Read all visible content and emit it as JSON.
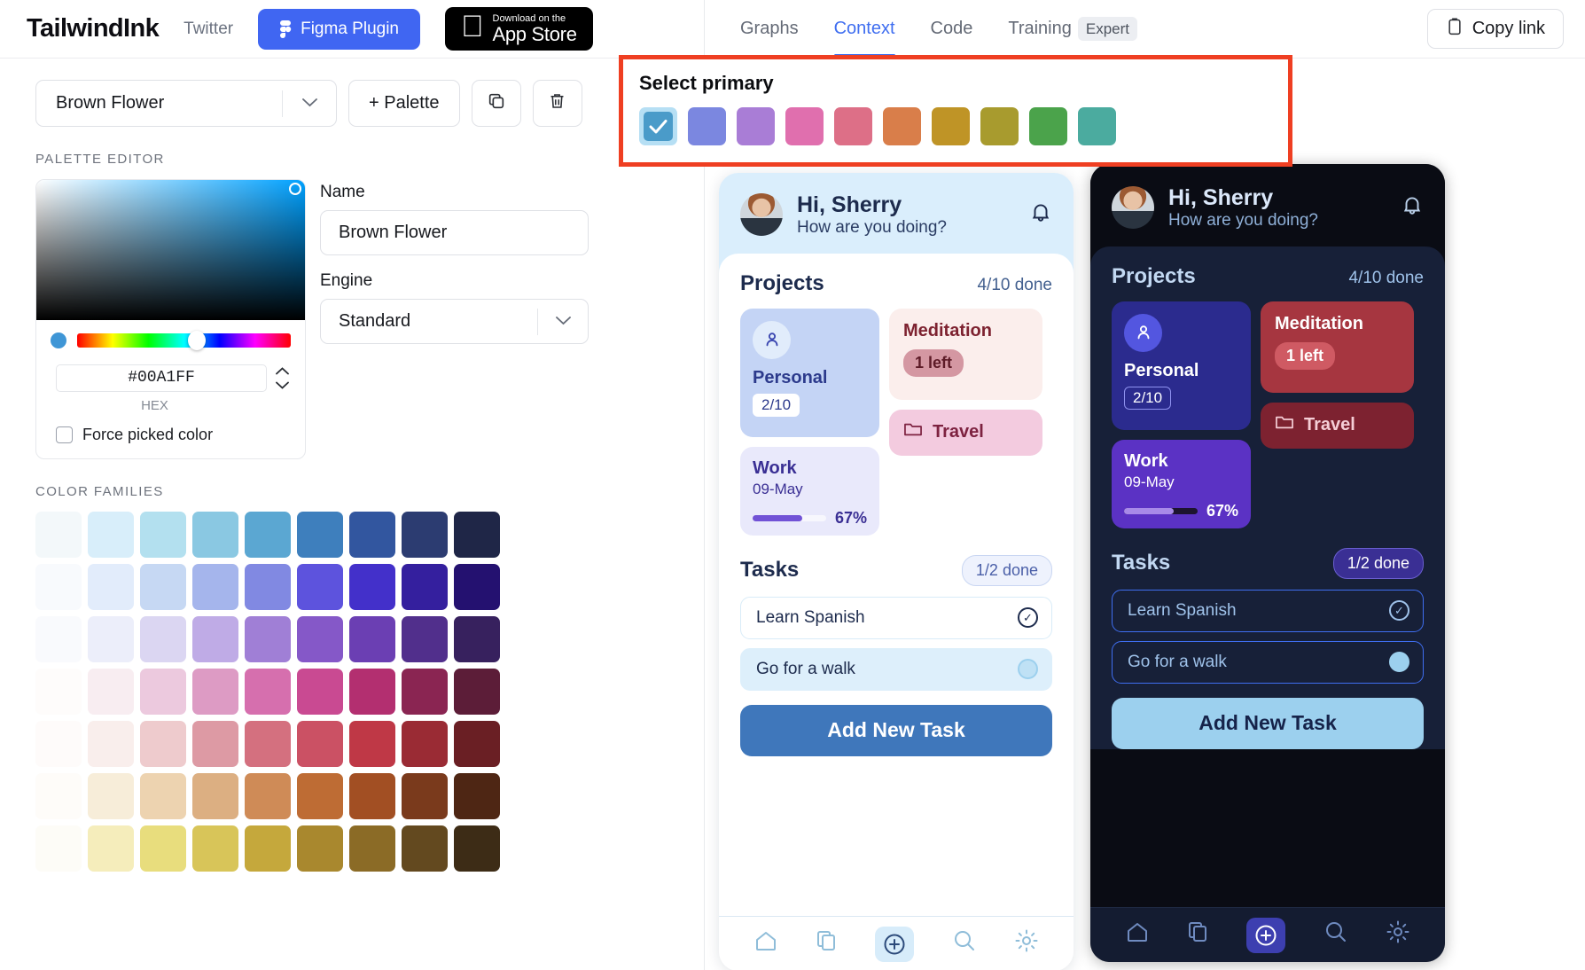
{
  "brand": {
    "logo": "TailwindInk",
    "twitter": "Twitter",
    "figma": "Figma Plugin",
    "appstore_small": "Download on the",
    "appstore_big": "App Store"
  },
  "palette_bar": {
    "selected_palette": "Brown Flower",
    "add_palette": "+ Palette",
    "duplicate_icon": "copy-icon",
    "delete_icon": "trash-icon",
    "chevron": "⌄"
  },
  "palette_editor": {
    "section_label": "PALETTE EDITOR",
    "hex_value": "#00A1FF",
    "hex_label": "HEX",
    "force_label": "Force picked color",
    "name_label": "Name",
    "name_value": "Brown Flower",
    "engine_label": "Engine",
    "engine_value": "Standard"
  },
  "color_families": {
    "section_label": "COLOR FAMILIES",
    "rows": [
      [
        "#f3f8fa",
        "#d8eefa",
        "#b3e0ef",
        "#8ac8e2",
        "#5ba7d2",
        "#3e7fbd",
        "#32569f",
        "#2c3c71",
        "#1f2647"
      ],
      [
        "#f8fafd",
        "#e2ecfb",
        "#c6d8f3",
        "#a5b5ec",
        "#8189e2",
        "#5d53dd",
        "#4330ca",
        "#341f9e",
        "#241170"
      ],
      [
        "#f9fafd",
        "#eceefa",
        "#dbd6f2",
        "#bfabe6",
        "#a07fd6",
        "#8558c8",
        "#6b3fb3",
        "#512f8c",
        "#37215e"
      ],
      [
        "#fefcfb",
        "#f8edf1",
        "#ecc9de",
        "#dd9bc4",
        "#d66fae",
        "#c94a92",
        "#b32f70",
        "#8a2552",
        "#5c1d38"
      ],
      [
        "#fefbfa",
        "#f9eeec",
        "#eecbcd",
        "#dd9aa4",
        "#d4707f",
        "#cb5164",
        "#bf3846",
        "#9a2b34",
        "#6a1f24"
      ],
      [
        "#fefcf9",
        "#f7edd9",
        "#edd3b0",
        "#dcaf82",
        "#cf8b57",
        "#be6c34",
        "#a24f23",
        "#7a3a1c",
        "#4e2614"
      ],
      [
        "#fdfcf7",
        "#f5edbb",
        "#e8dd7d",
        "#d8c559",
        "#c5a83c",
        "#a9882e",
        "#8b6b26",
        "#63491f",
        "#3d2c16"
      ]
    ]
  },
  "tabs": {
    "items": [
      {
        "label": "Graphs",
        "active": false,
        "badge": ""
      },
      {
        "label": "Context",
        "active": true,
        "badge": ""
      },
      {
        "label": "Code",
        "active": false,
        "badge": ""
      },
      {
        "label": "Training",
        "active": false,
        "badge": "Expert"
      }
    ],
    "copy_link": "Copy link",
    "copy_icon": "clipboard-icon"
  },
  "select_primary": {
    "title": "Select primary",
    "highlight_color": "#ef3f22",
    "selected_index": 0,
    "swatches": [
      "#4a9bc9",
      "#7b87e0",
      "#a97dd6",
      "#e06fae",
      "#dd6f87",
      "#d97e4a",
      "#bf9426",
      "#a89b2e",
      "#4ba34b",
      "#4bab9f"
    ],
    "check_icon": "check-icon"
  },
  "preview": {
    "light": {
      "greeting_name": "Hi, Sherry",
      "greeting_sub": "How are you doing?",
      "bell_icon": "bell-icon",
      "projects_title": "Projects",
      "projects_meta": "4/10 done",
      "personal": {
        "title": "Personal",
        "chip": "2/10",
        "icon": "user-icon"
      },
      "work": {
        "title": "Work",
        "date": "09-May",
        "pct": "67%",
        "progress": 67
      },
      "meditation": {
        "title": "Meditation",
        "chip": "1 left"
      },
      "travel": {
        "title": "Travel",
        "icon": "folder-icon"
      },
      "tasks_title": "Tasks",
      "tasks_meta": "1/2 done",
      "tasks": [
        {
          "label": "Learn Spanish",
          "done": true
        },
        {
          "label": "Go for a walk",
          "done": false
        }
      ],
      "add_task": "Add New Task",
      "navicons": [
        "home-icon",
        "copy-icon",
        "plus-circle-icon",
        "search-icon",
        "gear-icon"
      ],
      "colors": {
        "head_bg": "#daeefc",
        "body_bg": "#ffffff",
        "text": "#1d2b4d",
        "personal_bg": "#c4d4f5",
        "personal_ico_bg": "#e1ecfb",
        "personal_text": "#2c3a8c",
        "work_bg": "#e9e9fb",
        "work_text": "#3a2f94",
        "work_fill": "#7152d6",
        "work_track": "#f7f7fd",
        "med_bg": "#fbeeec",
        "med_text": "#7d2230",
        "med_chip_bg": "#d497a2",
        "med_chip_text": "#5d1b27",
        "travel_bg": "#f3cbdf",
        "travel_text": "#7d2240",
        "pill_bg": "#eef2fd",
        "pill_text": "#4a5fa8",
        "pill_border": "#c9d6f2",
        "task_done_bg": "#ffffff",
        "task_done_border": "#d9ecf8",
        "task_todo_bg": "#ddeffb",
        "task_text": "#1d2b4d",
        "add_bg": "#3f77bb",
        "add_text": "#ffffff",
        "nav_act_bg": "#d7ecfa",
        "nav_color": "#8fbdd9"
      }
    },
    "dark": {
      "greeting_name": "Hi, Sherry",
      "greeting_sub": "How are you doing?",
      "bell_icon": "bell-icon",
      "projects_title": "Projects",
      "projects_meta": "4/10 done",
      "personal": {
        "title": "Personal",
        "chip": "2/10",
        "icon": "user-icon"
      },
      "work": {
        "title": "Work",
        "date": "09-May",
        "pct": "67%",
        "progress": 67
      },
      "meditation": {
        "title": "Meditation",
        "chip": "1 left"
      },
      "travel": {
        "title": "Travel",
        "icon": "folder-icon"
      },
      "tasks_title": "Tasks",
      "tasks_meta": "1/2 done",
      "tasks": [
        {
          "label": "Learn Spanish",
          "done": true
        },
        {
          "label": "Go for a walk",
          "done": false
        }
      ],
      "add_task": "Add New Task",
      "navicons": [
        "home-icon",
        "copy-icon",
        "plus-circle-icon",
        "search-icon",
        "gear-icon"
      ],
      "colors": {
        "head_bg": "#0a0c14",
        "body_bg": "#172038",
        "text": "#c2d8f2",
        "personal_bg": "#2b2b8e",
        "personal_ico_bg": "#5356e0",
        "personal_text": "#ffffff",
        "work_bg": "#5b32c4",
        "work_text": "#ffffff",
        "work_fill": "#a88ae8",
        "work_track": "#1d1430",
        "med_bg": "#a63640",
        "med_text": "#ffffff",
        "med_chip_bg": "#cf5a63",
        "med_chip_text": "#ffffff",
        "travel_bg": "#7d2230",
        "travel_text": "#f5ced6",
        "pill_bg": "#3a2f94",
        "pill_text": "#ffffff",
        "pill_border": "#6a5fd0",
        "task_done_bg": "#172038",
        "task_done_border": "#3f6ef0",
        "task_todo_bg": "#172038",
        "task_text": "#9fc2ea",
        "add_bg": "#9cd0ee",
        "add_text": "#16234a",
        "nav_act_bg": "#3d3fb0",
        "nav_color": "#6f8bc0"
      }
    }
  }
}
